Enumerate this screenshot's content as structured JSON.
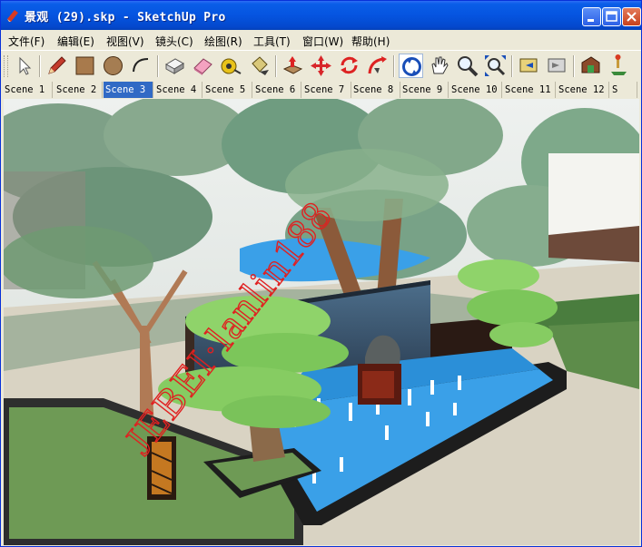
{
  "window": {
    "title": "景观 (29).skp - SketchUp Pro",
    "title_color": "#0554e0"
  },
  "menu": [
    {
      "label": "文件(F)"
    },
    {
      "label": "编辑(E)"
    },
    {
      "label": "视图(V)"
    },
    {
      "label": "镜头(C)"
    },
    {
      "label": "绘图(R)"
    },
    {
      "label": "工具(T)"
    },
    {
      "label": "窗口(W)"
    },
    {
      "label": "帮助(H)"
    }
  ],
  "toolbar": [
    "select-icon",
    "pencil-icon",
    "rectangle-icon",
    "circle-icon",
    "arc-icon",
    "make-component-icon",
    "eraser-icon",
    "tape-measure-icon",
    "paint-bucket-icon",
    "push-pull-icon",
    "move-icon",
    "rotate-icon",
    "follow-me-icon",
    "orbit-icon",
    "pan-icon",
    "zoom-icon",
    "zoom-extents-icon",
    "previous-view-icon",
    "next-view-icon",
    "warehouse-icon",
    "sandbox-icon"
  ],
  "scenes": {
    "active": 3,
    "tabs": [
      "Scene 1",
      "Scene 2",
      "Scene 3",
      "Scene 4",
      "Scene 5",
      "Scene 6",
      "Scene 7",
      "Scene 8",
      "Scene 9",
      "Scene 10",
      "Scene 11",
      "Scene 12",
      "S"
    ]
  },
  "viewport": {
    "watermark": "JEBEI·lanlin188",
    "watermark_color": "#e02020",
    "water_color": "#3aa0e8"
  }
}
